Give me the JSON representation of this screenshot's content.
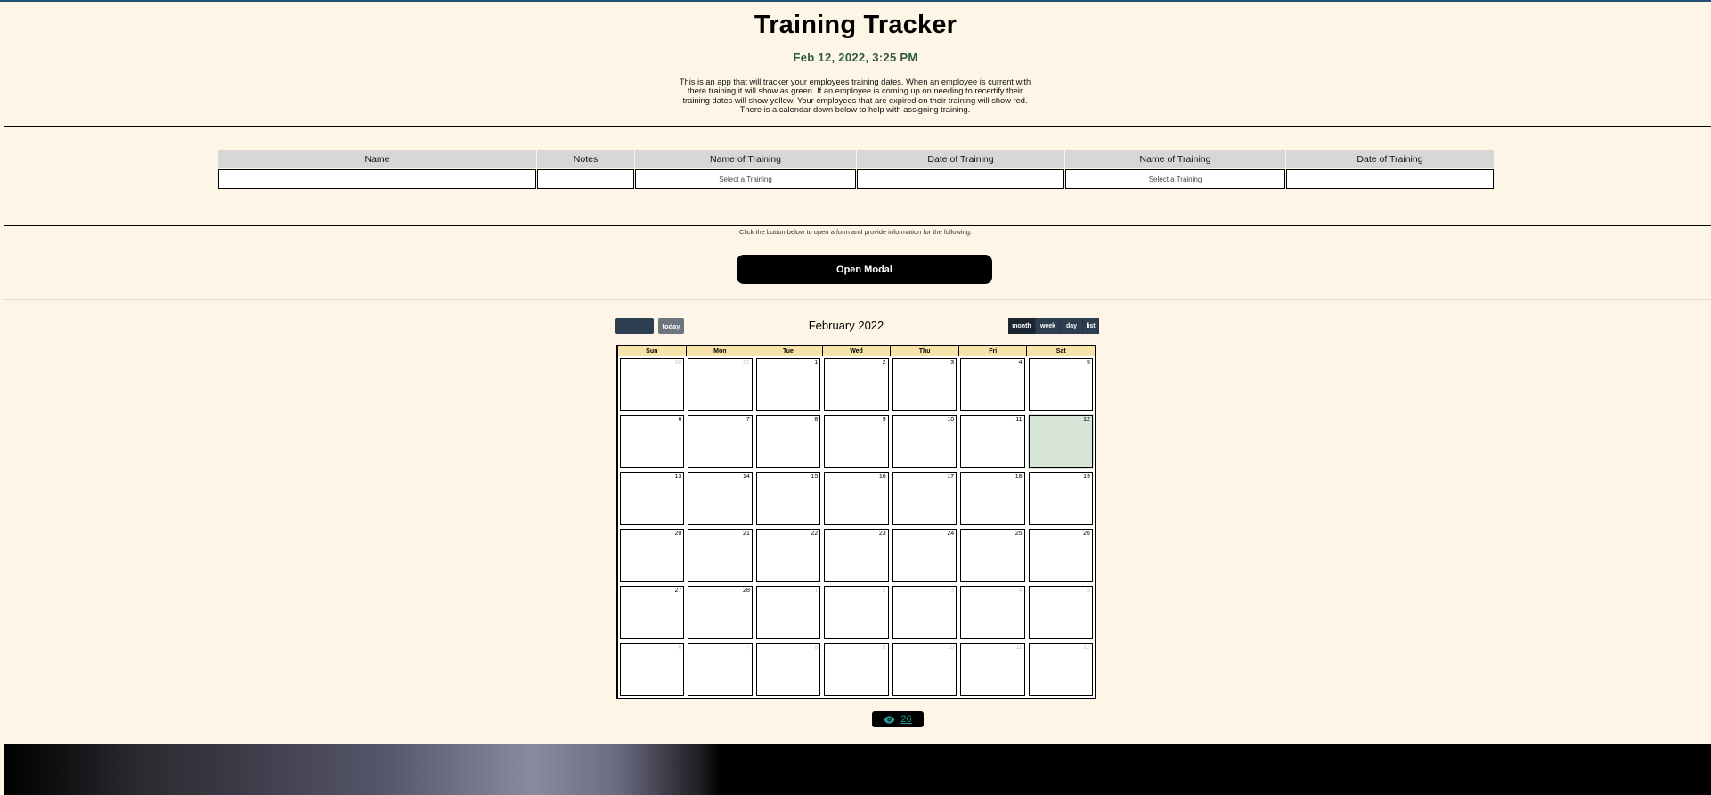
{
  "header": {
    "title": "Training Tracker",
    "datetime": "Feb 12, 2022, 3:25 PM",
    "description": "This is an app that will tracker your employees training dates. When an employee is current with there training it will show as green. If an employee is coming up on needing to recertify their training dates will show yellow. Your employees that are expired on their training will show red. There is a calendar down below to help with assigning training."
  },
  "employee_table": {
    "columns": [
      "Name",
      "Notes",
      "Name of Training",
      "Date of Training",
      "Name of Training",
      "Date of Training"
    ],
    "row": [
      "",
      "",
      "Select a Training",
      "",
      "Select a Training",
      ""
    ]
  },
  "form_section": {
    "instruction": "Click the button below to open a form and provide information for the following:",
    "open_modal_label": "Open Modal"
  },
  "calendar": {
    "today_label": "today",
    "title": "February 2022",
    "views": [
      "month",
      "week",
      "day",
      "list"
    ],
    "active_view": "month",
    "day_headers": [
      "Sun",
      "Mon",
      "Tue",
      "Wed",
      "Thu",
      "Fri",
      "Sat"
    ],
    "weeks": [
      [
        {
          "d": "30",
          "o": true
        },
        {
          "d": "31",
          "o": true
        },
        {
          "d": "1"
        },
        {
          "d": "2"
        },
        {
          "d": "3"
        },
        {
          "d": "4"
        },
        {
          "d": "5"
        }
      ],
      [
        {
          "d": "6"
        },
        {
          "d": "7"
        },
        {
          "d": "8"
        },
        {
          "d": "9"
        },
        {
          "d": "10"
        },
        {
          "d": "11"
        },
        {
          "d": "12",
          "t": true
        }
      ],
      [
        {
          "d": "13"
        },
        {
          "d": "14"
        },
        {
          "d": "15"
        },
        {
          "d": "16"
        },
        {
          "d": "17"
        },
        {
          "d": "18"
        },
        {
          "d": "19"
        }
      ],
      [
        {
          "d": "20"
        },
        {
          "d": "21"
        },
        {
          "d": "22"
        },
        {
          "d": "23"
        },
        {
          "d": "24"
        },
        {
          "d": "25"
        },
        {
          "d": "26"
        }
      ],
      [
        {
          "d": "27"
        },
        {
          "d": "28"
        },
        {
          "d": "1",
          "o": true
        },
        {
          "d": "2",
          "o": true
        },
        {
          "d": "3",
          "o": true
        },
        {
          "d": "4",
          "o": true
        },
        {
          "d": "5",
          "o": true
        }
      ],
      [
        {
          "d": "6",
          "o": true
        },
        {
          "d": "7",
          "o": true
        },
        {
          "d": "8",
          "o": true
        },
        {
          "d": "9",
          "o": true
        },
        {
          "d": "10",
          "o": true
        },
        {
          "d": "11",
          "o": true
        },
        {
          "d": "12",
          "o": true
        }
      ]
    ],
    "today_color": "#d6e5d8"
  },
  "view_counter": {
    "icon": "eye-icon",
    "count": "26"
  }
}
